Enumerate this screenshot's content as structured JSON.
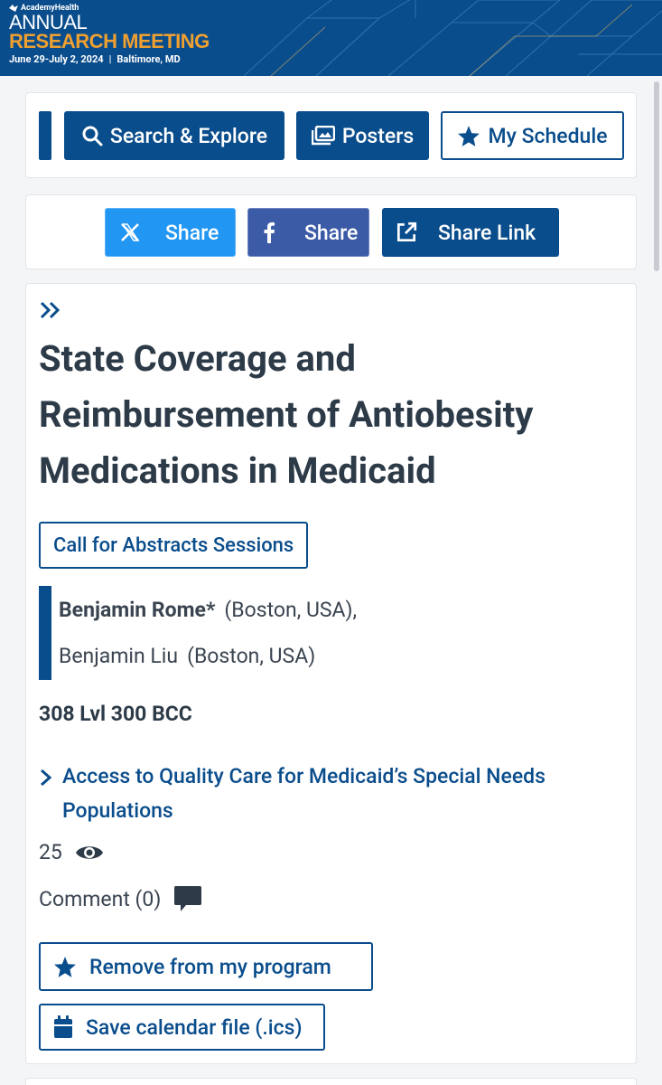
{
  "header": {
    "org": "AcademyHealth",
    "line1": "ANNUAL",
    "line2": "RESEARCH MEETING",
    "dates": "June 29-July 2, 2024",
    "location": "Baltimore, MD"
  },
  "nav": {
    "search_label": "Search & Explore",
    "posters_label": "Posters",
    "schedule_label": "My Schedule"
  },
  "share": {
    "x_label": "Share",
    "facebook_label": "Share",
    "link_label": "Share Link"
  },
  "abstract": {
    "title": "State Coverage and Reimbursement of Antiobesity Medications in Medicaid",
    "tag": "Call for Abstracts Sessions",
    "authors": [
      {
        "name": "Benjamin Rome*",
        "location": "(Boston, USA),"
      },
      {
        "name": "Benjamin Liu",
        "location": "(Boston, USA)"
      }
    ],
    "room": "308 Lvl 300 BCC",
    "session": "Access to Quality Care for Medicaid’s Special Needs Populations",
    "views": "25",
    "comments": "Comment (0)",
    "remove_label": "Remove from my program",
    "calendar_label": "Save calendar file (.ics)"
  },
  "colors": {
    "brand_blue": "#0a4d8c",
    "accent_orange": "#f0a030",
    "x_blue": "#2196f3",
    "facebook_blue": "#3b5ba6"
  },
  "icons": [
    "search-icon",
    "images-icon",
    "star-icon",
    "x-logo-icon",
    "facebook-icon",
    "external-link-icon",
    "double-chevron-icon",
    "chevron-right-icon",
    "eye-icon",
    "comment-icon",
    "calendar-icon"
  ]
}
